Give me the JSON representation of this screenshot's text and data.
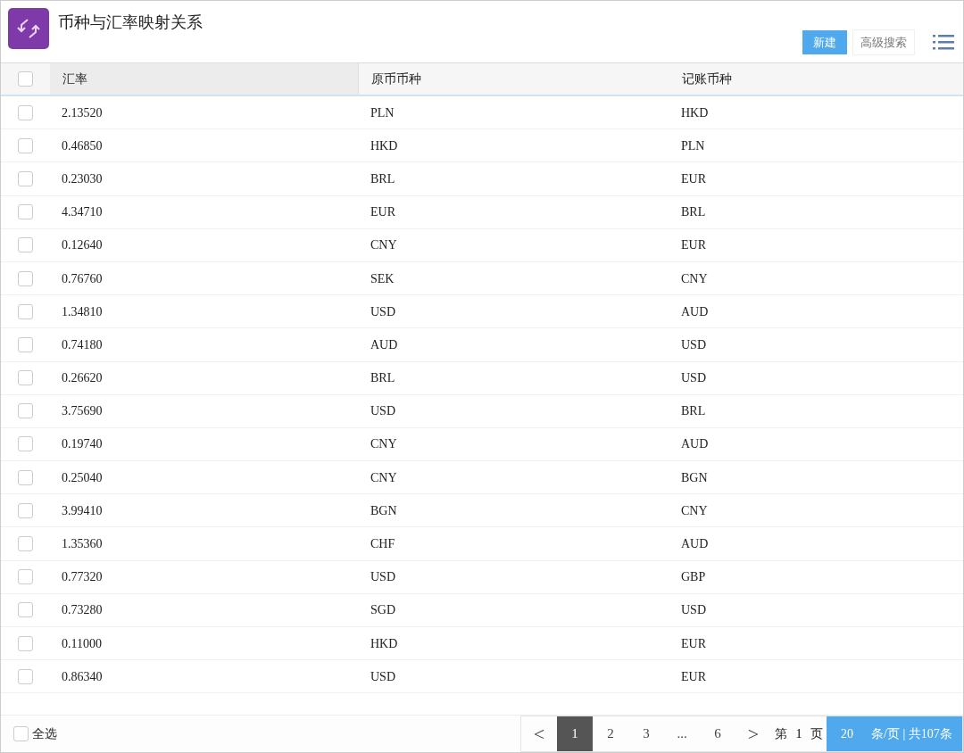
{
  "header": {
    "title": "币种与汇率映射关系",
    "buttons": [
      {
        "label": "新建",
        "kind": "primary"
      },
      {
        "label": "高级搜索",
        "kind": "secondary"
      }
    ]
  },
  "table": {
    "select_all_checked": false,
    "columns": [
      {
        "label": "汇率",
        "sorted": true
      },
      {
        "label": "原币币种",
        "sorted": false
      },
      {
        "label": "记账币种",
        "sorted": false
      }
    ],
    "rows": [
      {
        "checked": false,
        "cells": [
          "2.13520",
          "PLN",
          "HKD"
        ]
      },
      {
        "checked": false,
        "cells": [
          "0.46850",
          "HKD",
          "PLN"
        ]
      },
      {
        "checked": false,
        "cells": [
          "0.23030",
          "BRL",
          "EUR"
        ]
      },
      {
        "checked": false,
        "cells": [
          "4.34710",
          "EUR",
          "BRL"
        ]
      },
      {
        "checked": false,
        "cells": [
          "0.12640",
          "CNY",
          "EUR"
        ]
      },
      {
        "checked": false,
        "cells": [
          "0.76760",
          "SEK",
          "CNY"
        ]
      },
      {
        "checked": false,
        "cells": [
          "1.34810",
          "USD",
          "AUD"
        ]
      },
      {
        "checked": false,
        "cells": [
          "0.74180",
          "AUD",
          "USD"
        ]
      },
      {
        "checked": false,
        "cells": [
          "0.26620",
          "BRL",
          "USD"
        ]
      },
      {
        "checked": false,
        "cells": [
          "3.75690",
          "USD",
          "BRL"
        ]
      },
      {
        "checked": false,
        "cells": [
          "0.19740",
          "CNY",
          "AUD"
        ]
      },
      {
        "checked": false,
        "cells": [
          "0.25040",
          "CNY",
          "BGN"
        ]
      },
      {
        "checked": false,
        "cells": [
          "3.99410",
          "BGN",
          "CNY"
        ]
      },
      {
        "checked": false,
        "cells": [
          "1.35360",
          "CHF",
          "AUD"
        ]
      },
      {
        "checked": false,
        "cells": [
          "0.77320",
          "USD",
          "GBP"
        ]
      },
      {
        "checked": false,
        "cells": [
          "0.73280",
          "SGD",
          "USD"
        ]
      },
      {
        "checked": false,
        "cells": [
          "0.11000",
          "HKD",
          "EUR"
        ]
      },
      {
        "checked": false,
        "cells": [
          "0.86340",
          "USD",
          "EUR"
        ]
      }
    ]
  },
  "footer": {
    "select_all": {
      "label": "全选",
      "checked": false
    },
    "pagination": {
      "prev": "<",
      "pages": [
        {
          "label": "1",
          "selected": true
        },
        {
          "label": "2",
          "selected": false
        },
        {
          "label": "3",
          "selected": false
        },
        {
          "label": "...",
          "selected": false
        },
        {
          "label": "6",
          "selected": false
        }
      ],
      "next": ">",
      "page_prefix": "第",
      "page_value": "1",
      "page_suffix": "页",
      "page_size": "20",
      "summary": "条/页 | 共107条"
    }
  }
}
